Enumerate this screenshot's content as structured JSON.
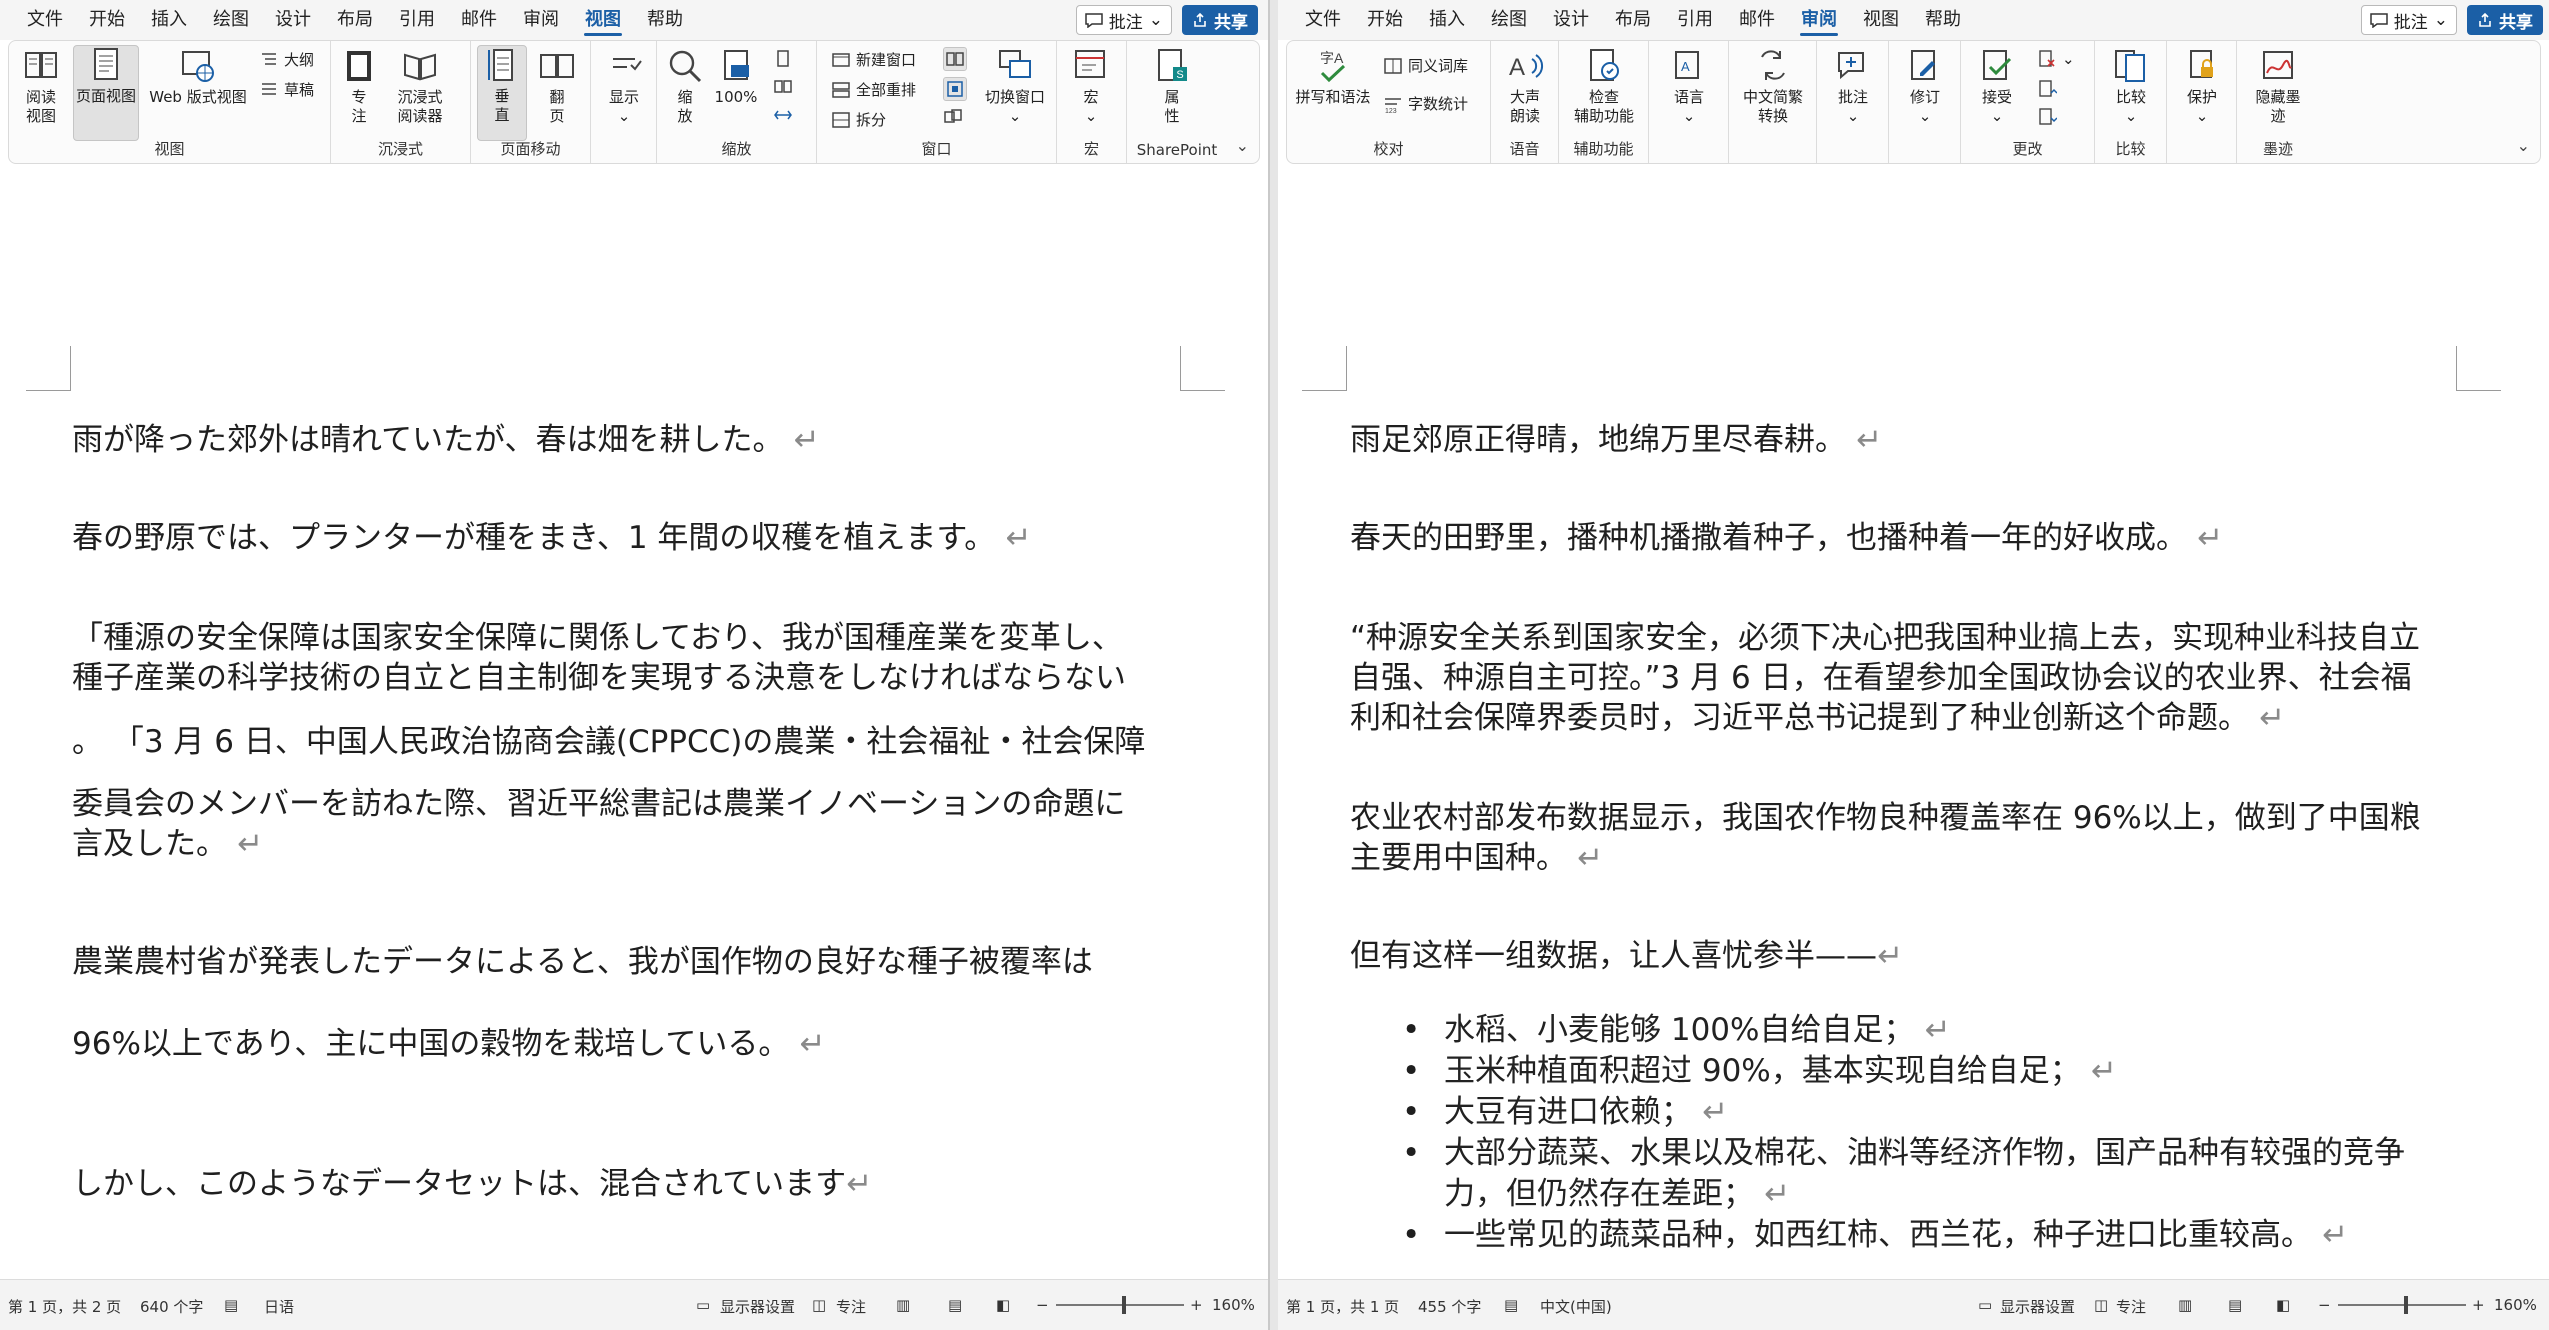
{
  "left": {
    "tabs": [
      "文件",
      "开始",
      "插入",
      "绘图",
      "设计",
      "布局",
      "引用",
      "邮件",
      "审阅",
      "视图",
      "帮助"
    ],
    "active_tab": "视图",
    "comment_label": "批注",
    "share_label": "共享",
    "ribbon": {
      "read_view": "阅读\n视图",
      "print_layout": "页面视图",
      "web_layout": "Web 版式视图",
      "outline": "大纲",
      "draft": "草稿",
      "group_view": "视图",
      "focus": "专\n注",
      "immersive_reader": "沉浸式\n阅读器",
      "group_immersive": "沉浸式",
      "vertical": "垂\n直",
      "side_to_side": "翻\n页",
      "group_page_move": "页面移动",
      "show": "显示",
      "zoom": "缩\n放",
      "zoom_100": "100%",
      "group_zoom": "缩放",
      "new_window": "新建窗口",
      "arrange_all": "全部重排",
      "split": "拆分",
      "switch_windows": "切换窗口",
      "group_window": "窗口",
      "macros": "宏",
      "group_macros": "宏",
      "properties": "属\n性",
      "group_sharepoint": "SharePoint"
    },
    "paragraphs": [
      "雨が降った郊外は晴れていたが、春は畑を耕した。",
      "春の野原では、プランターが種をまき、1 年間の収穫を植えます。",
      "「種源の安全保障は国家安全保障に関係しており、我が国種産業を変革し、",
      "種子産業の科学技術の自立と自主制御を実現する決意をしなければならない",
      "。 「3 月 6 日、中国人民政治協商会議(CPPCC)の農業・社会福祉・社会保障",
      "委員会のメンバーを訪ねた際、習近平総書記は農業イノベーションの命題に",
      "言及した。",
      "農業農村省が発表したデータによると、我が国作物の良好な種子被覆率は",
      "96%以上であり、主に中国の穀物を栽培している。",
      "しかし、このようなデータセットは、混合されています"
    ],
    "status": {
      "page": "第 1 页，共 2 页",
      "words": "640 个字",
      "language": "日语",
      "display_settings": "显示器设置",
      "focus": "专注",
      "zoom": "160%"
    }
  },
  "right": {
    "tabs": [
      "文件",
      "开始",
      "插入",
      "绘图",
      "设计",
      "布局",
      "引用",
      "邮件",
      "审阅",
      "视图",
      "帮助"
    ],
    "active_tab": "审阅",
    "comment_label": "批注",
    "share_label": "共享",
    "ribbon": {
      "spelling": "拼写和语法",
      "thesaurus": "同义词库",
      "word_count": "字数统计",
      "group_proofing": "校对",
      "read_aloud": "大声\n朗读",
      "group_speech": "语音",
      "check_accessibility": "检查\n辅助功能",
      "group_accessibility": "辅助功能",
      "language": "语言",
      "chinese_conversion": "中文简繁\n转换",
      "comments": "批注",
      "tracking": "修订",
      "accept": "接受",
      "group_changes": "更改",
      "compare": "比较",
      "group_compare": "比较",
      "protect": "保护",
      "hide_ink": "隐藏墨\n迹",
      "group_ink": "墨迹"
    },
    "paragraphs": [
      "雨足郊原正得晴，地绵万里尽春耕。",
      "春天的田野里，播种机播撒着种子，也播种着一年的好收成。",
      "“种源安全关系到国家安全，必须下决心把我国种业搞上去，实现种业科技自立",
      "自强、种源自主可控。”3 月 6 日，在看望参加全国政协会议的农业界、社会福",
      "利和社会保障界委员时，习近平总书记提到了种业创新这个命题。",
      "农业农村部发布数据显示，我国农作物良种覆盖率在 96%以上，做到了中国粮",
      "主要用中国种。",
      "但有这样一组数据，让人喜忧参半——"
    ],
    "bullets": [
      "水稻、小麦能够 100%自给自足；",
      "玉米种植面积超过 90%，基本实现自给自足；",
      "大豆有进口依赖；",
      "大部分蔬菜、水果以及棉花、油料等经济作物，国产品种有较强的竞争",
      "力，但仍然存在差距；",
      "一些常见的蔬菜品种，如西红柿、西兰花，种子进口比重较高。"
    ],
    "status": {
      "page": "第 1 页，共 1 页",
      "words": "455 个字",
      "language": "中文(中国)",
      "display_settings": "显示器设置",
      "focus": "专注",
      "zoom": "160%"
    }
  },
  "return_mark": "↵"
}
